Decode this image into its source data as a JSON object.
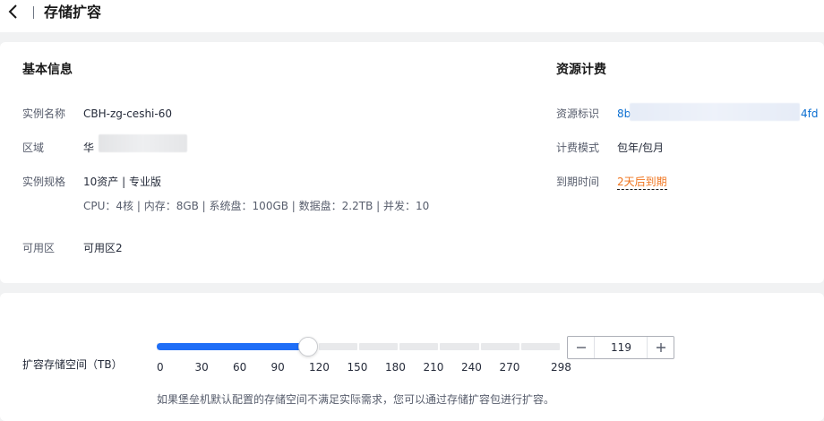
{
  "header": {
    "title": "存储扩容",
    "back_icon": "chevron-left-icon"
  },
  "basic": {
    "title": "基本信息",
    "instance_name_label": "实例名称",
    "instance_name": "CBH-zg-ceshi-60",
    "region_label": "区域",
    "region_prefix": "华",
    "spec_label": "实例规格",
    "spec": "10资产 | 专业版",
    "spec_detail": "CPU：4核 | 内存：8GB | 系统盘：100GB | 数据盘：2.2TB | 并发：10",
    "az_label": "可用区",
    "az": "可用区2"
  },
  "billing": {
    "title": "资源计费",
    "resource_id_label": "资源标识",
    "resource_id_start": "8b",
    "resource_id_end": "4fd",
    "mode_label": "计费模式",
    "mode": "包年/包月",
    "expire_label": "到期时间",
    "expire": "2天后到期",
    "colors": {
      "link": "#0a6ed1",
      "warning": "#f0751f"
    }
  },
  "expand": {
    "label": "扩容存储空间（TB）",
    "min": 0,
    "max": 298,
    "value": "119",
    "ticks": [
      "0",
      "30",
      "60",
      "90",
      "120",
      "150",
      "180",
      "210",
      "240",
      "270",
      "298"
    ],
    "accent": "#1f6ef7",
    "minus_icon": "minus-icon",
    "plus_icon": "plus-icon",
    "tip": "如果堡垒机默认配置的存储空间不满足实际需求，您可以通过存储扩容包进行扩容。"
  }
}
